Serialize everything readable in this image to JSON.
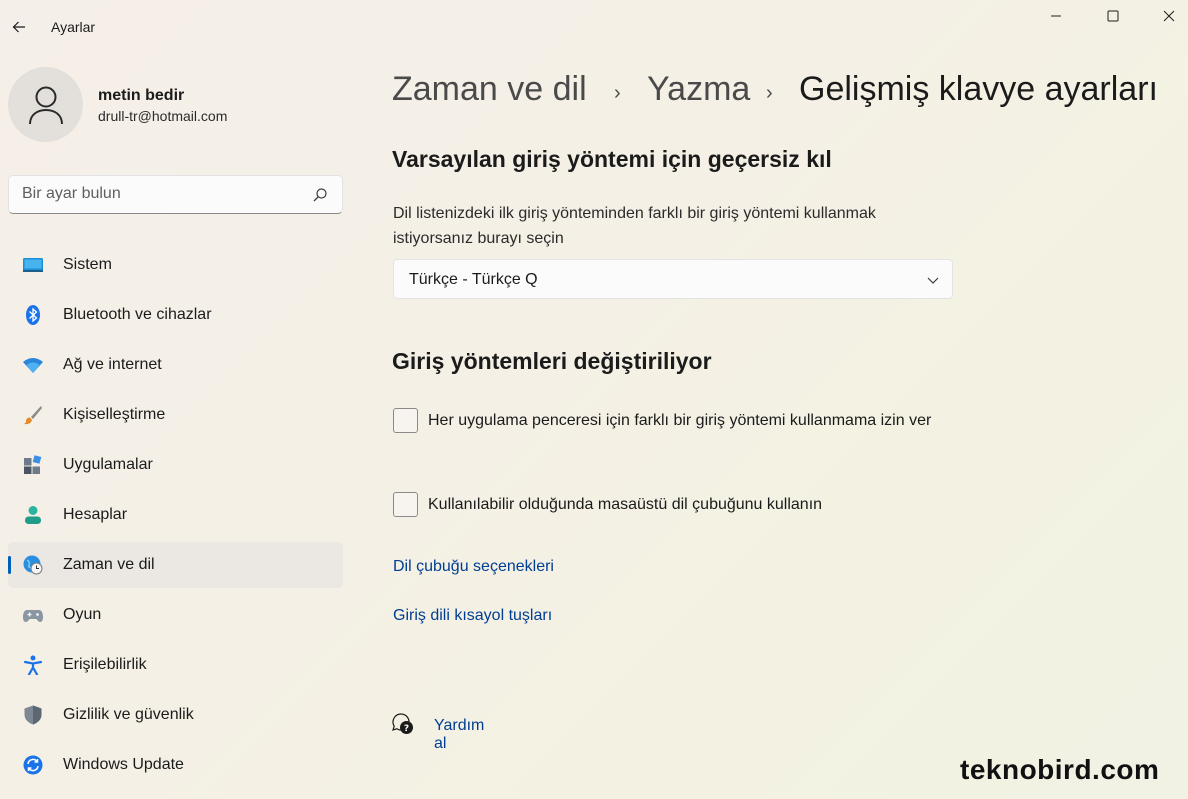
{
  "window": {
    "app_title": "Ayarlar"
  },
  "profile": {
    "name": "metin bedir",
    "email": "drull-tr@hotmail.com"
  },
  "search": {
    "placeholder": "Bir ayar bulun"
  },
  "sidebar": {
    "items": [
      {
        "label": "Sistem",
        "icon": "monitor-icon"
      },
      {
        "label": "Bluetooth ve cihazlar",
        "icon": "bluetooth-icon"
      },
      {
        "label": "Ağ ve internet",
        "icon": "wifi-icon"
      },
      {
        "label": "Kişiselleştirme",
        "icon": "paintbrush-icon"
      },
      {
        "label": "Uygulamalar",
        "icon": "apps-icon"
      },
      {
        "label": "Hesaplar",
        "icon": "person-icon"
      },
      {
        "label": "Zaman ve dil",
        "icon": "globe-clock-icon",
        "active": true
      },
      {
        "label": "Oyun",
        "icon": "gamepad-icon"
      },
      {
        "label": "Erişilebilirlik",
        "icon": "accessibility-icon"
      },
      {
        "label": "Gizlilik ve güvenlik",
        "icon": "shield-icon"
      },
      {
        "label": "Windows Update",
        "icon": "update-icon"
      }
    ]
  },
  "breadcrumb": {
    "part1": "Zaman ve dil",
    "part2": "Yazma",
    "current": "Gelişmiş klavye ayarları",
    "separator": "›"
  },
  "override_section": {
    "title": "Varsayılan giriş yöntemi için geçersiz kıl",
    "description": "Dil listenizdeki ilk giriş yönteminden farklı bir giriş yöntemi kullanmak istiyorsanız burayı seçin",
    "dropdown_value": "Türkçe - Türkçe Q"
  },
  "switching_section": {
    "title": "Giriş yöntemleri değiştiriliyor",
    "checkbox1_label": "Her uygulama penceresi için farklı bir giriş yöntemi kullanmama izin ver",
    "checkbox1_checked": false,
    "checkbox2_label": "Kullanılabilir olduğunda masaüstü dil çubuğunu kullanın",
    "checkbox2_checked": false
  },
  "links": {
    "language_bar_options": "Dil çubuğu seçenekleri",
    "input_hotkeys": "Giriş dili kısayol tuşları"
  },
  "help": {
    "label": "Yardım al"
  },
  "watermark": "teknobird.com",
  "colors": {
    "accent": "#005fb8",
    "link": "#003e92"
  }
}
